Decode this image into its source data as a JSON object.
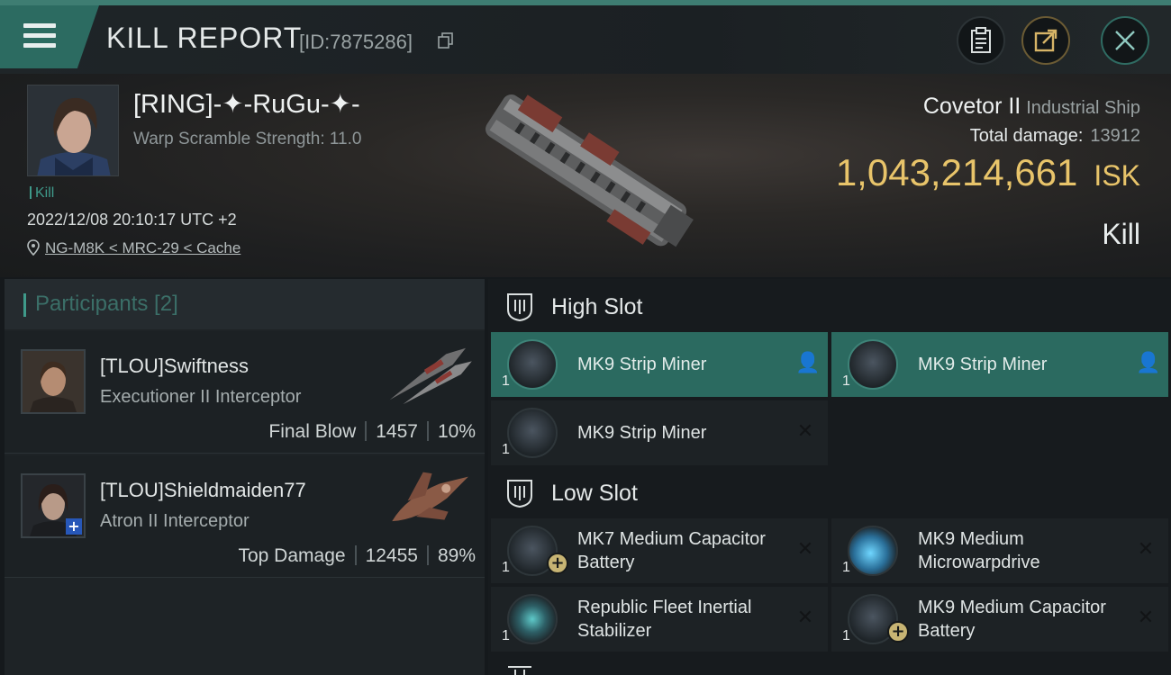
{
  "header": {
    "title": "KILL REPORT",
    "report_id": "[ID:7875286]",
    "menu_icon": "menu-icon",
    "clipboard_icon": "clipboard-icon",
    "share_icon": "share-icon",
    "close_icon": "close-icon"
  },
  "victim": {
    "name": "[RING]-✦-RuGu-✦-",
    "warp_scramble": "Warp Scramble Strength: 11.0",
    "kill_tag": "Kill",
    "datetime": "2022/12/08 20:10:17 UTC +2",
    "location": "NG-M8K < MRC-29 < Cache",
    "ship_name": "Covetor II",
    "ship_class": "Industrial Ship",
    "total_damage_label": "Total damage:",
    "total_damage_value": "13912",
    "isk_value": "1,043,214,661",
    "isk_unit": "ISK",
    "result": "Kill"
  },
  "participants": {
    "label": "Participants [2]",
    "items": [
      {
        "name": "[TLOU]Swiftness",
        "ship": "Executioner II Interceptor",
        "role": "Final Blow",
        "damage": "1457",
        "percent": "10%"
      },
      {
        "name": "[TLOU]Shieldmaiden77",
        "ship": "Atron II Interceptor",
        "role": "Top Damage",
        "damage": "12455",
        "percent": "89%"
      }
    ]
  },
  "fitting": {
    "high_slot_label": "High Slot",
    "low_slot_label": "Low Slot",
    "high_slot": [
      {
        "name": "MK9 Strip Miner",
        "qty": "1",
        "status": "pilot"
      },
      {
        "name": "MK9 Strip Miner",
        "qty": "1",
        "status": "pilot"
      },
      {
        "name": "MK9 Strip Miner",
        "qty": "1",
        "status": "destroyed"
      }
    ],
    "low_slot": [
      {
        "name": "MK7 Medium Capacitor Battery",
        "qty": "1",
        "status": "destroyed"
      },
      {
        "name": "MK9 Medium Microwarpdrive",
        "qty": "1",
        "status": "destroyed"
      },
      {
        "name": "Republic Fleet Inertial Stabilizer",
        "qty": "1",
        "status": "destroyed"
      },
      {
        "name": "MK9 Medium Capacitor Battery",
        "qty": "1",
        "status": "destroyed"
      }
    ]
  },
  "colors": {
    "accent": "#2b6a60",
    "isk": "#e8c46a",
    "kill_tag": "#3f9a8a"
  }
}
